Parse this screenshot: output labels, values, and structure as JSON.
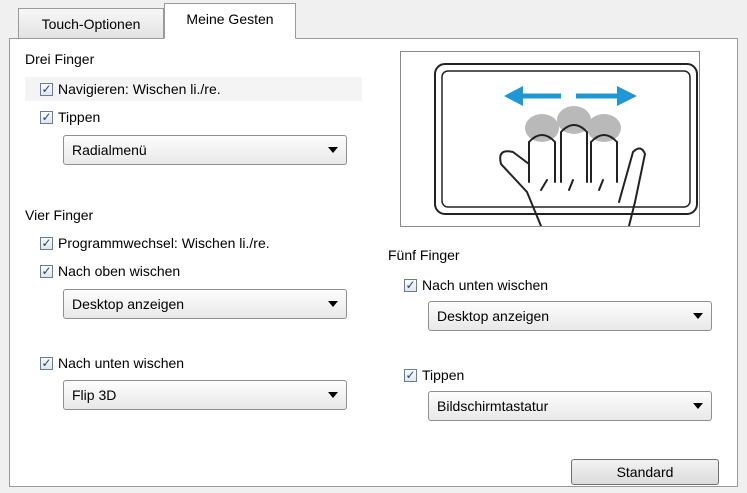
{
  "tabs": [
    {
      "label": "Touch-Optionen",
      "active": false
    },
    {
      "label": "Meine Gesten",
      "active": true
    }
  ],
  "three_finger": {
    "title": "Drei Finger",
    "navigate": {
      "label": "Navigieren: Wischen li./re.",
      "checked": true
    },
    "tap": {
      "label": "Tippen",
      "checked": true
    },
    "tap_action": "Radialmenü"
  },
  "four_finger": {
    "title": "Vier Finger",
    "switch": {
      "label": "Programmwechsel: Wischen li./re.",
      "checked": true
    },
    "swipe_up": {
      "label": "Nach oben wischen",
      "checked": true
    },
    "swipe_up_action": "Desktop anzeigen",
    "swipe_down": {
      "label": "Nach unten wischen",
      "checked": true
    },
    "swipe_down_action": "Flip 3D"
  },
  "five_finger": {
    "title": "Fünf Finger",
    "swipe_down": {
      "label": "Nach unten wischen",
      "checked": true
    },
    "swipe_down_action": "Desktop anzeigen",
    "tap": {
      "label": "Tippen",
      "checked": true
    },
    "tap_action": "Bildschirmtastatur"
  },
  "buttons": {
    "standard": "Standard"
  },
  "colors": {
    "accent_arrow": "#1f97d4",
    "fingertip": "#b9b9b9"
  }
}
